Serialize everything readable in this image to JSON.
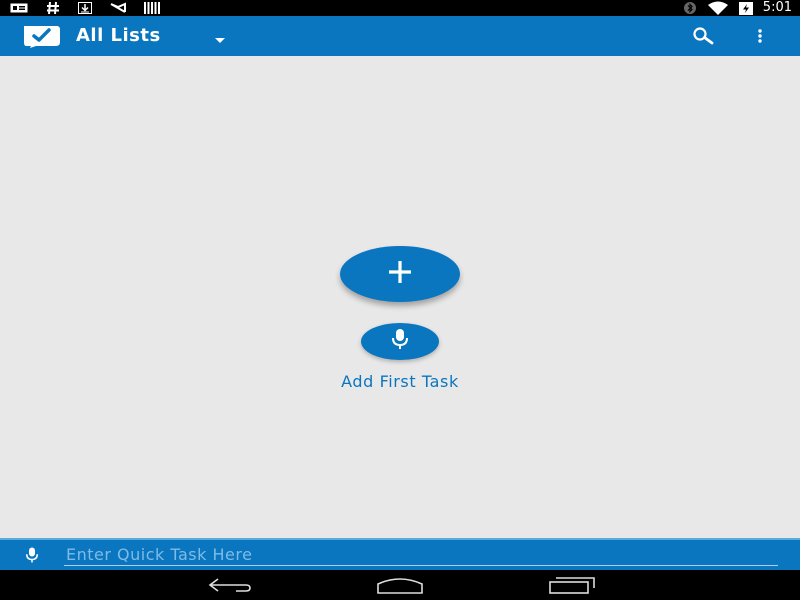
{
  "status_bar": {
    "time": "5:01",
    "left_icons": [
      "message-icon",
      "hash-icon",
      "download-icon",
      "gmail-icon",
      "barcode-icon"
    ],
    "right_icons": [
      "bluetooth-icon",
      "wifi-icon",
      "battery-charging-icon"
    ]
  },
  "app_bar": {
    "title": "All Lists",
    "logo_icon": "checkmark-logo-icon",
    "actions": [
      "search-icon",
      "overflow-menu-icon"
    ]
  },
  "main": {
    "add_button_icon": "plus-icon",
    "voice_button_icon": "microphone-icon",
    "add_first_task_label": "Add First Task"
  },
  "quick_task": {
    "placeholder": "Enter Quick Task Here",
    "value": ""
  },
  "nav_bar": {
    "buttons": [
      "back-icon",
      "home-icon",
      "recents-icon"
    ]
  },
  "colors": {
    "primary": "#0a76c0",
    "background": "#e8e8e8",
    "system_bars": "#000000",
    "placeholder": "#7fbbe6"
  }
}
